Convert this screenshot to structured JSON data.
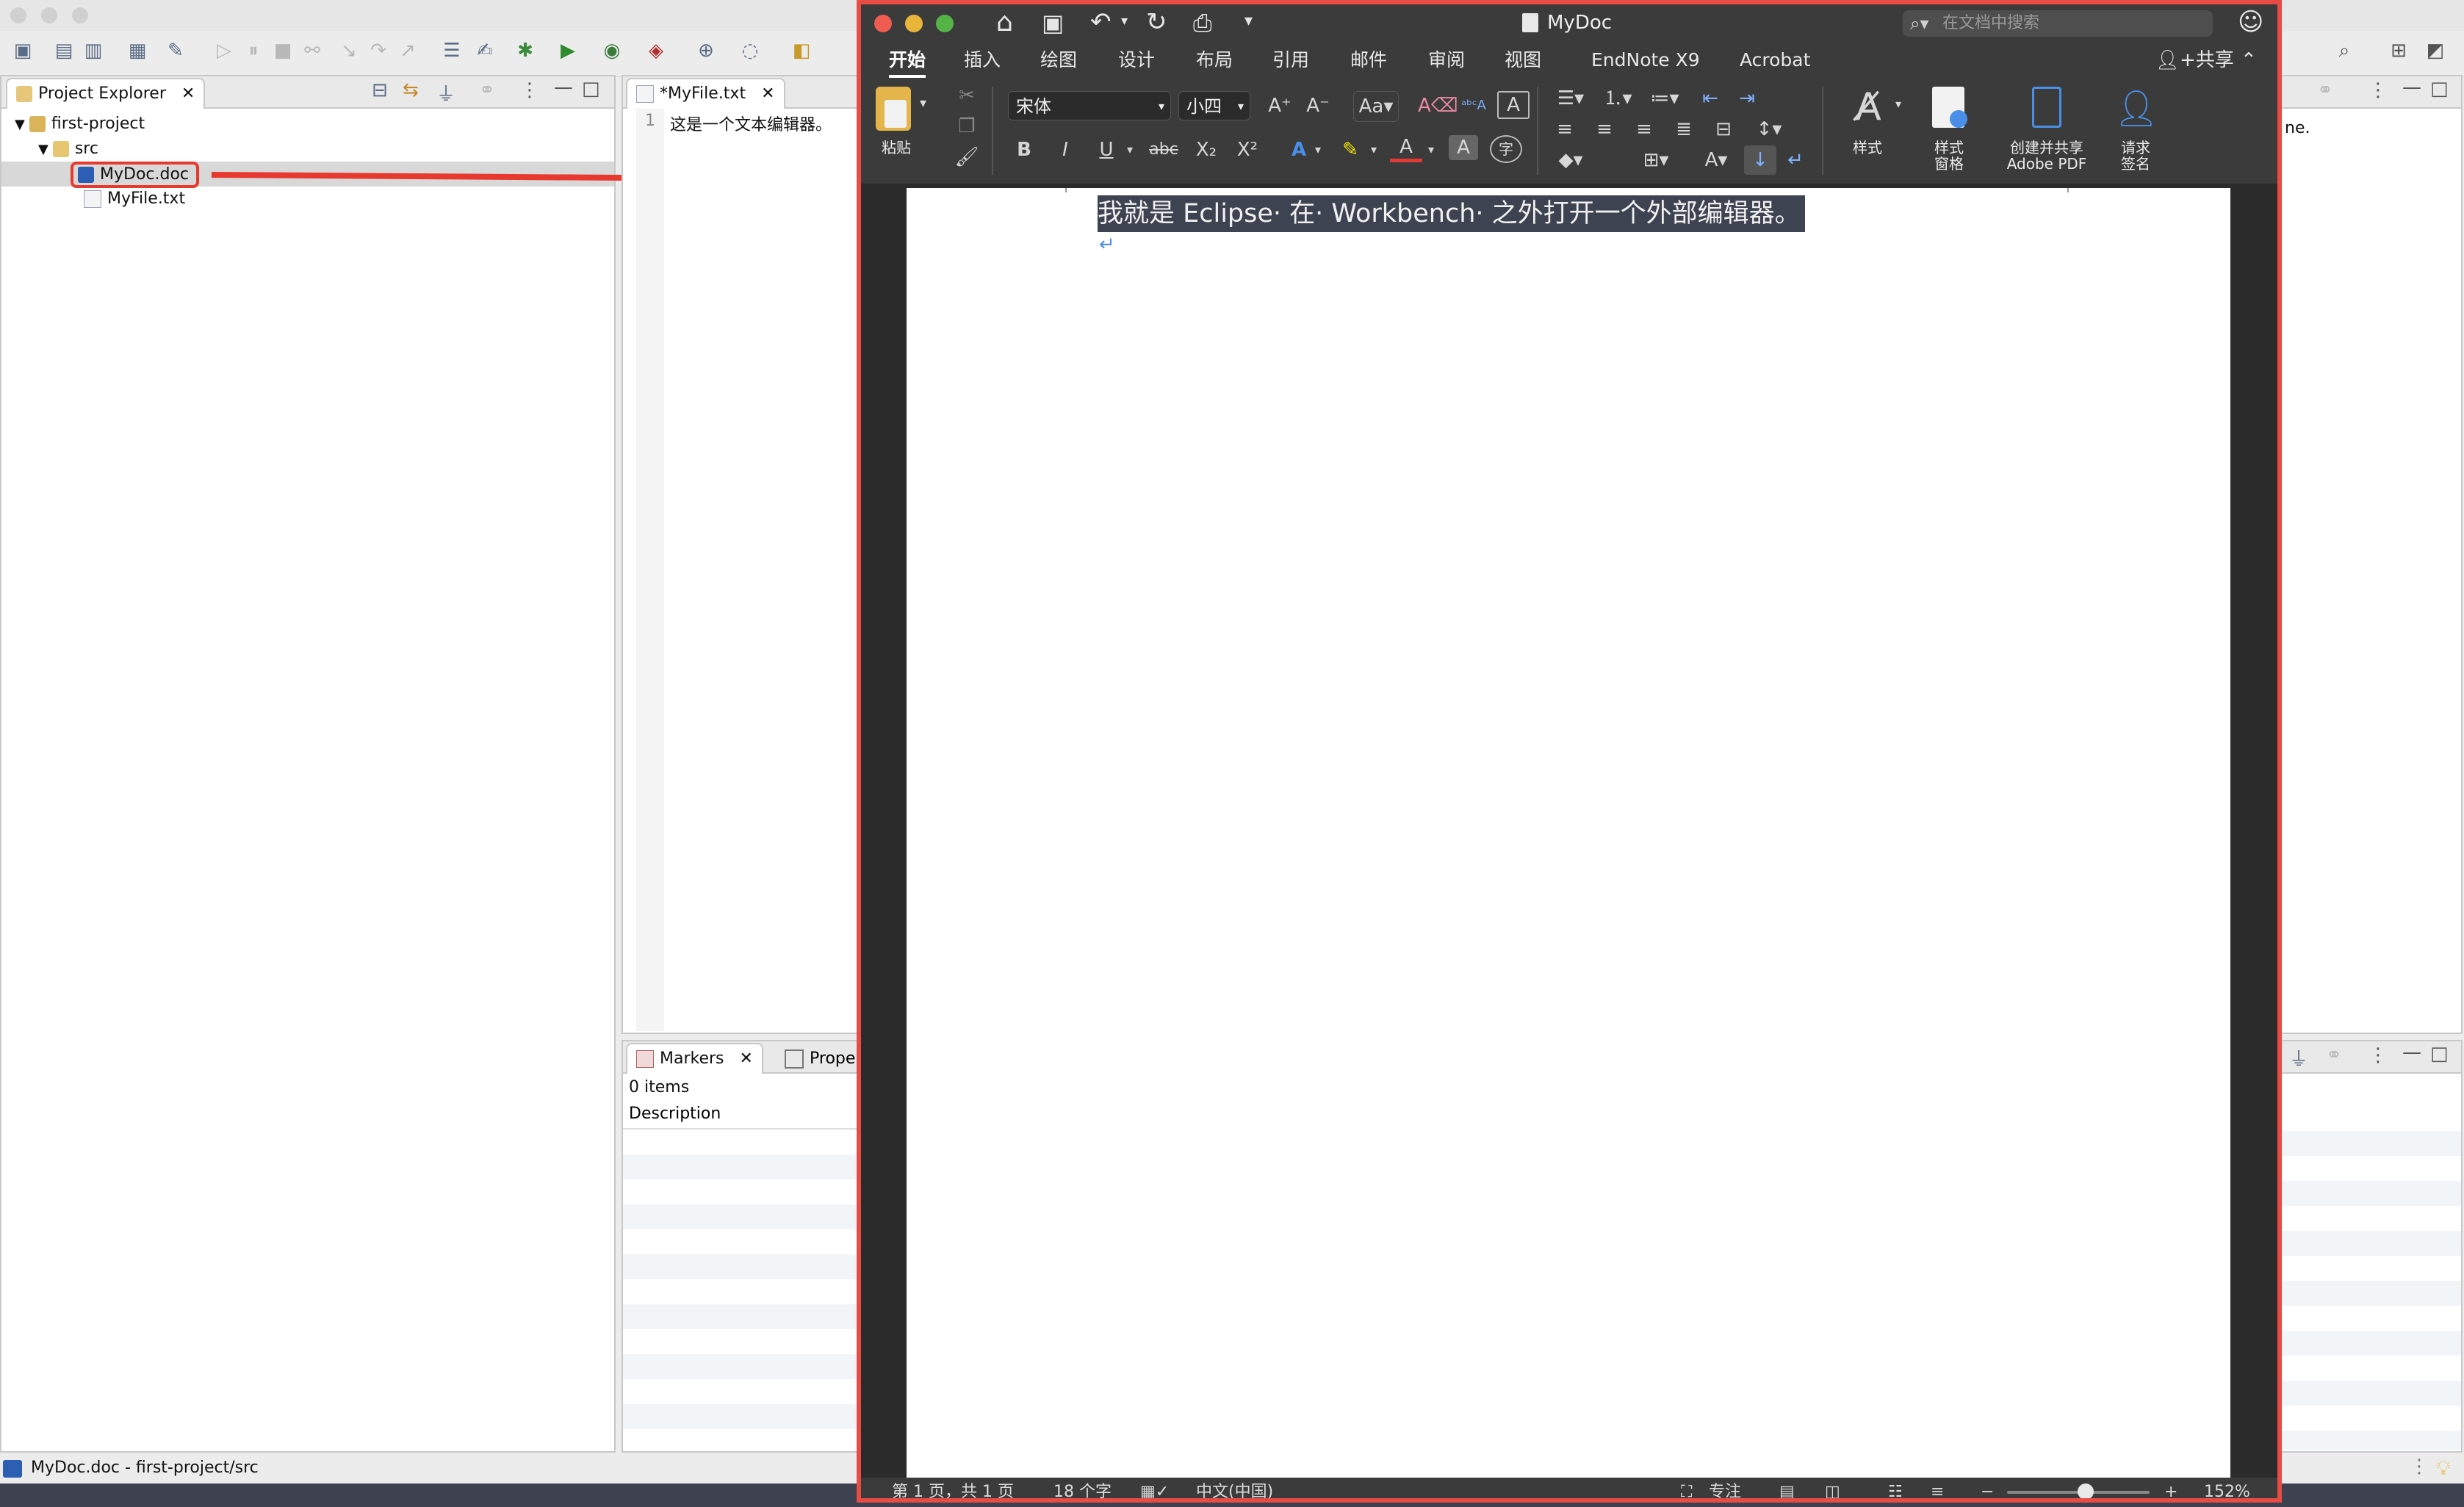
{
  "eclipse": {
    "project_explorer": {
      "tab_label": "Project Explorer",
      "tree": [
        {
          "label": "first-project",
          "icon": "project-folder-icon"
        },
        {
          "label": "src",
          "icon": "folder-icon"
        },
        {
          "label": "MyDoc.doc",
          "icon": "word-doc-icon",
          "selected": true
        },
        {
          "label": "MyFile.txt",
          "icon": "text-file-icon"
        }
      ]
    },
    "editor": {
      "tab_label": "*MyFile.txt",
      "line_number": "1",
      "line_text": "这是一个文本编辑器。"
    },
    "markers": {
      "tab_label": "Markers",
      "properties_tab_label": "Prope",
      "count_text": "0 items",
      "column_header": "Description"
    },
    "right_truncated_text": "ne.",
    "status_bar": {
      "text": "MyDoc.doc - first-project/src"
    }
  },
  "word": {
    "title": "MyDoc",
    "search_placeholder": "在文档中搜索",
    "ribbon_tabs": [
      "开始",
      "插入",
      "绘图",
      "设计",
      "布局",
      "引用",
      "邮件",
      "审阅",
      "视图",
      "EndNote X9",
      "Acrobat"
    ],
    "share_label": "共享",
    "font_name": "宋体",
    "font_size": "小四",
    "paste_label": "粘贴",
    "styles_label": "样式",
    "styles_pane_label": [
      "样式",
      "窗格"
    ],
    "create_pdf_label": [
      "创建并共享",
      "Adobe PDF"
    ],
    "request_sign_label": [
      "请求",
      "签名"
    ],
    "document_text": "我就是 Eclipse· 在· Workbench· 之外打开一个外部编辑器。",
    "status": {
      "page": "第 1 页，共 1 页",
      "words": "18 个字",
      "language": "中文(中国)",
      "focus": "专注",
      "zoom": "152%",
      "zoom_level": 0.55
    },
    "colors": {
      "highlight_border": "#e8392f",
      "selection": "#3d4350",
      "accent_blue": "#4a8fe7"
    }
  }
}
